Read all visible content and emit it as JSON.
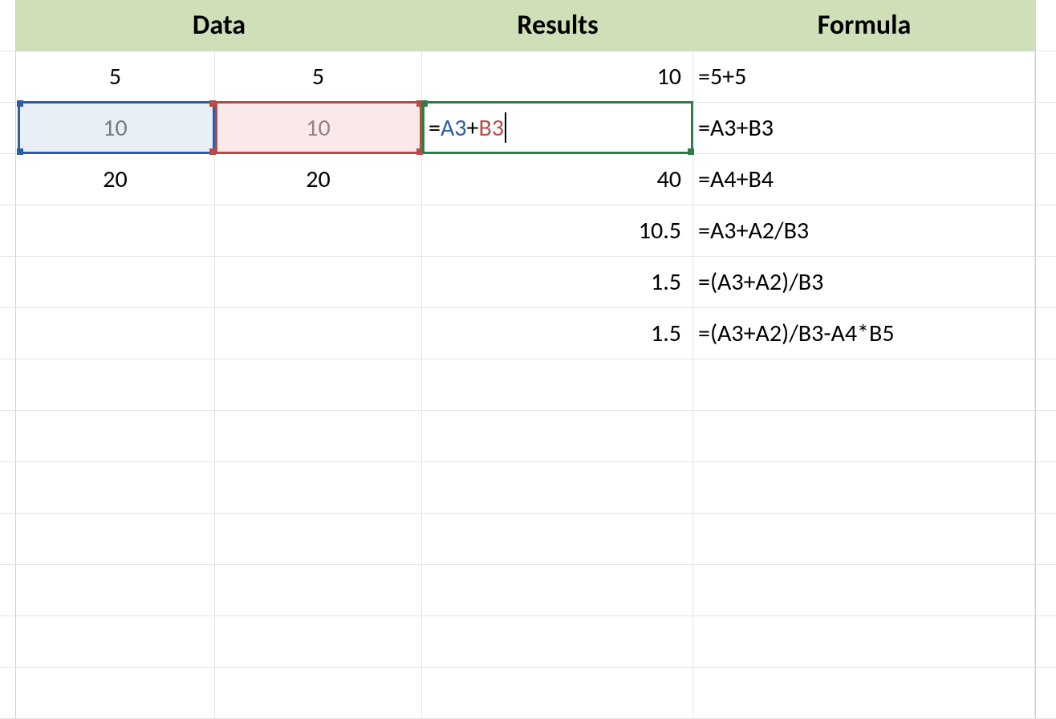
{
  "headers": {
    "data": "Data",
    "results": "Results",
    "formula": "Formula"
  },
  "rows": [
    {
      "dataA": "5",
      "dataB": "5",
      "result": "10",
      "formula": "=5+5"
    },
    {
      "dataA": "10",
      "dataB": "10",
      "result": "",
      "formula": "=A3+B3"
    },
    {
      "dataA": "20",
      "dataB": "20",
      "result": "40",
      "formula": "=A4+B4"
    },
    {
      "dataA": "",
      "dataB": "",
      "result": "10.5",
      "formula": "=A3+A2/B3"
    },
    {
      "dataA": "",
      "dataB": "",
      "result": "1.5",
      "formula": "=(A3+A2)/B3"
    },
    {
      "dataA": "",
      "dataB": "",
      "result": "1.5",
      "formula": "=(A3+A2)/B3-A4*B5"
    }
  ],
  "editing_cell": {
    "address": "C3",
    "tokens": {
      "eq": "=",
      "ref1": "A3",
      "op": "+",
      "ref2": "B3"
    },
    "ref1_color": "#2a5ca9",
    "ref2_color": "#b84b47",
    "active_border_color": "#2e7d45"
  },
  "highlight_refs": {
    "blue_cell": "A3",
    "red_cell": "B3"
  },
  "blank_extra_rows": 7
}
